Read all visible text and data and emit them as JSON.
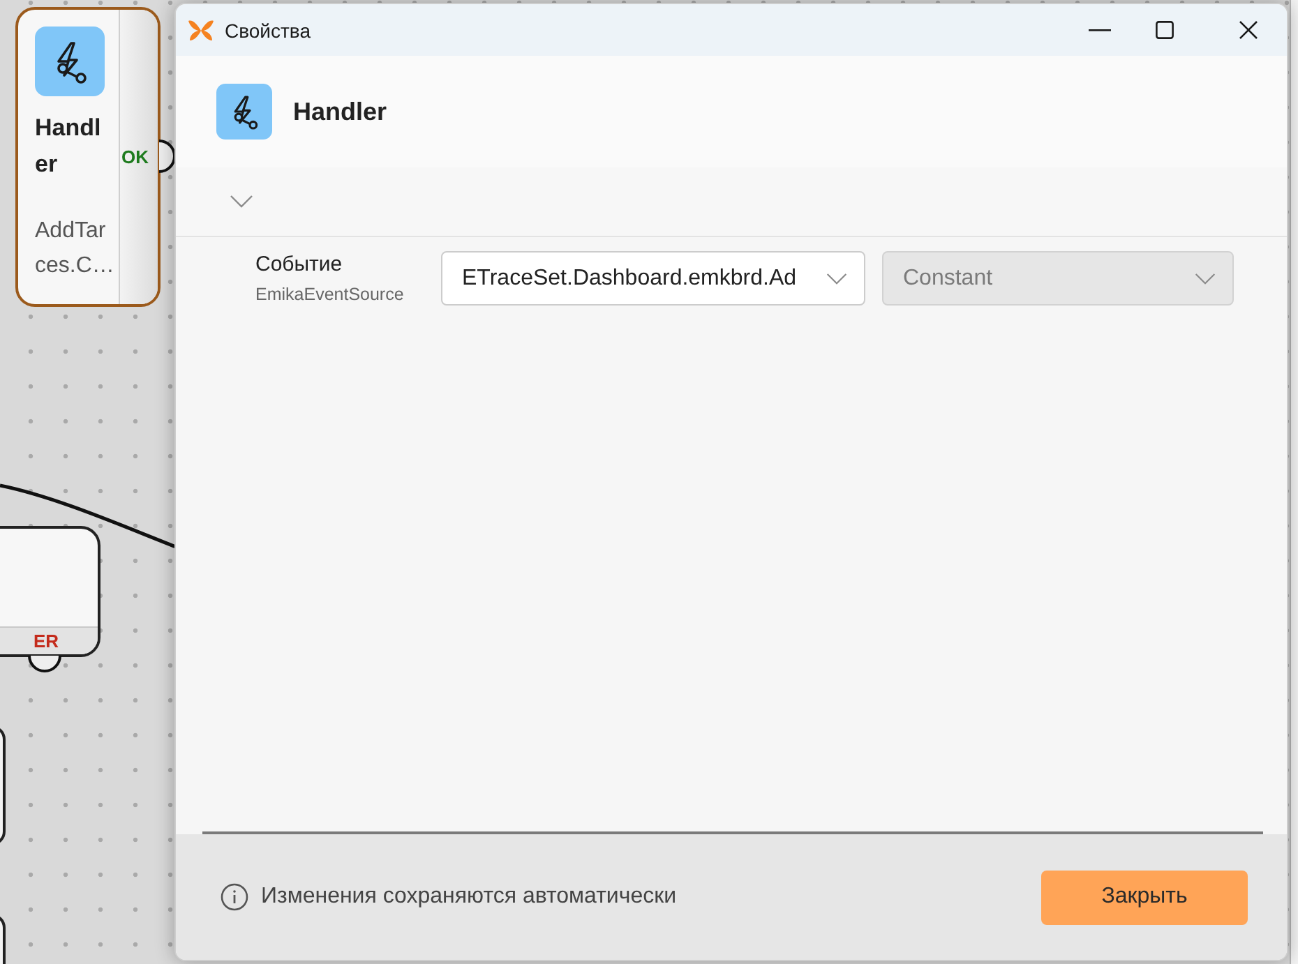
{
  "canvas": {
    "nodes": [
      {
        "kind": "handler",
        "selected": true,
        "title": "Handler",
        "subtitle": "AddTarces.C…",
        "port": {
          "label": "OK",
          "color": "#1e7b1e"
        }
      },
      {
        "kind": "block",
        "selected": false,
        "port": {
          "label": "ER",
          "color": "#c42b1c"
        }
      }
    ]
  },
  "dialog": {
    "title": "Свойства",
    "header": {
      "title": "Handler"
    },
    "properties": [
      {
        "label": "Событие",
        "type_name": "EmikaEventSource",
        "value": "ETraceSet.Dashboard.emkbrd.Ad",
        "mode": {
          "value": "Constant",
          "disabled": true
        }
      }
    ],
    "footer": {
      "note": "Изменения сохраняются автоматически",
      "close_button": "Закрыть"
    }
  }
}
